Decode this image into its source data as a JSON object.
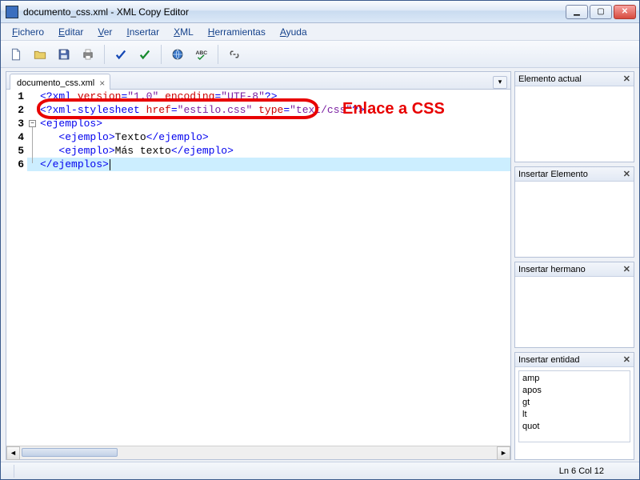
{
  "window": {
    "title": "documento_css.xml - XML Copy Editor"
  },
  "menu": {
    "fichero": "Fichero",
    "editar": "Editar",
    "ver": "Ver",
    "insertar": "Insertar",
    "xml": "XML",
    "herramientas": "Herramientas",
    "ayuda": "Ayuda"
  },
  "tab": {
    "label": "documento_css.xml"
  },
  "code": {
    "lines": [
      "1",
      "2",
      "3",
      "4",
      "5",
      "6"
    ],
    "l1": {
      "a": "<?",
      "b": "xml ",
      "c": "version",
      "d": "=",
      "e": "\"1.0\" ",
      "f": "encoding",
      "g": "=",
      "h": "\"UTF-8\"",
      "i": "?>"
    },
    "l2": {
      "a": "<?",
      "b": "xml-stylesheet ",
      "c": "href",
      "d": "=",
      "e": "\"estilo.css\" ",
      "f": "type",
      "g": "=",
      "h": "\"text/css\"",
      "i": "?>"
    },
    "l3": {
      "a": "<",
      "b": "ejemplos",
      "c": ">"
    },
    "l4": {
      "ind": "   ",
      "a": "<",
      "b": "ejemplo",
      "c": ">",
      "t": "Texto",
      "d": "</",
      "e": "ejemplo",
      "f": ">"
    },
    "l5": {
      "ind": "   ",
      "a": "<",
      "b": "ejemplo",
      "c": ">",
      "t": "Más texto",
      "d": "</",
      "e": "ejemplo",
      "f": ">"
    },
    "l6": {
      "a": "</",
      "b": "ejemplos",
      "c": ">"
    }
  },
  "annotation": {
    "label": "Enlace a CSS"
  },
  "panels": {
    "current": "Elemento actual",
    "insertElement": "Insertar Elemento",
    "insertSibling": "Insertar hermano",
    "insertEntity": "Insertar entidad",
    "entities": [
      "amp",
      "apos",
      "gt",
      "lt",
      "quot"
    ]
  },
  "status": {
    "pos": "Ln 6 Col 12"
  }
}
